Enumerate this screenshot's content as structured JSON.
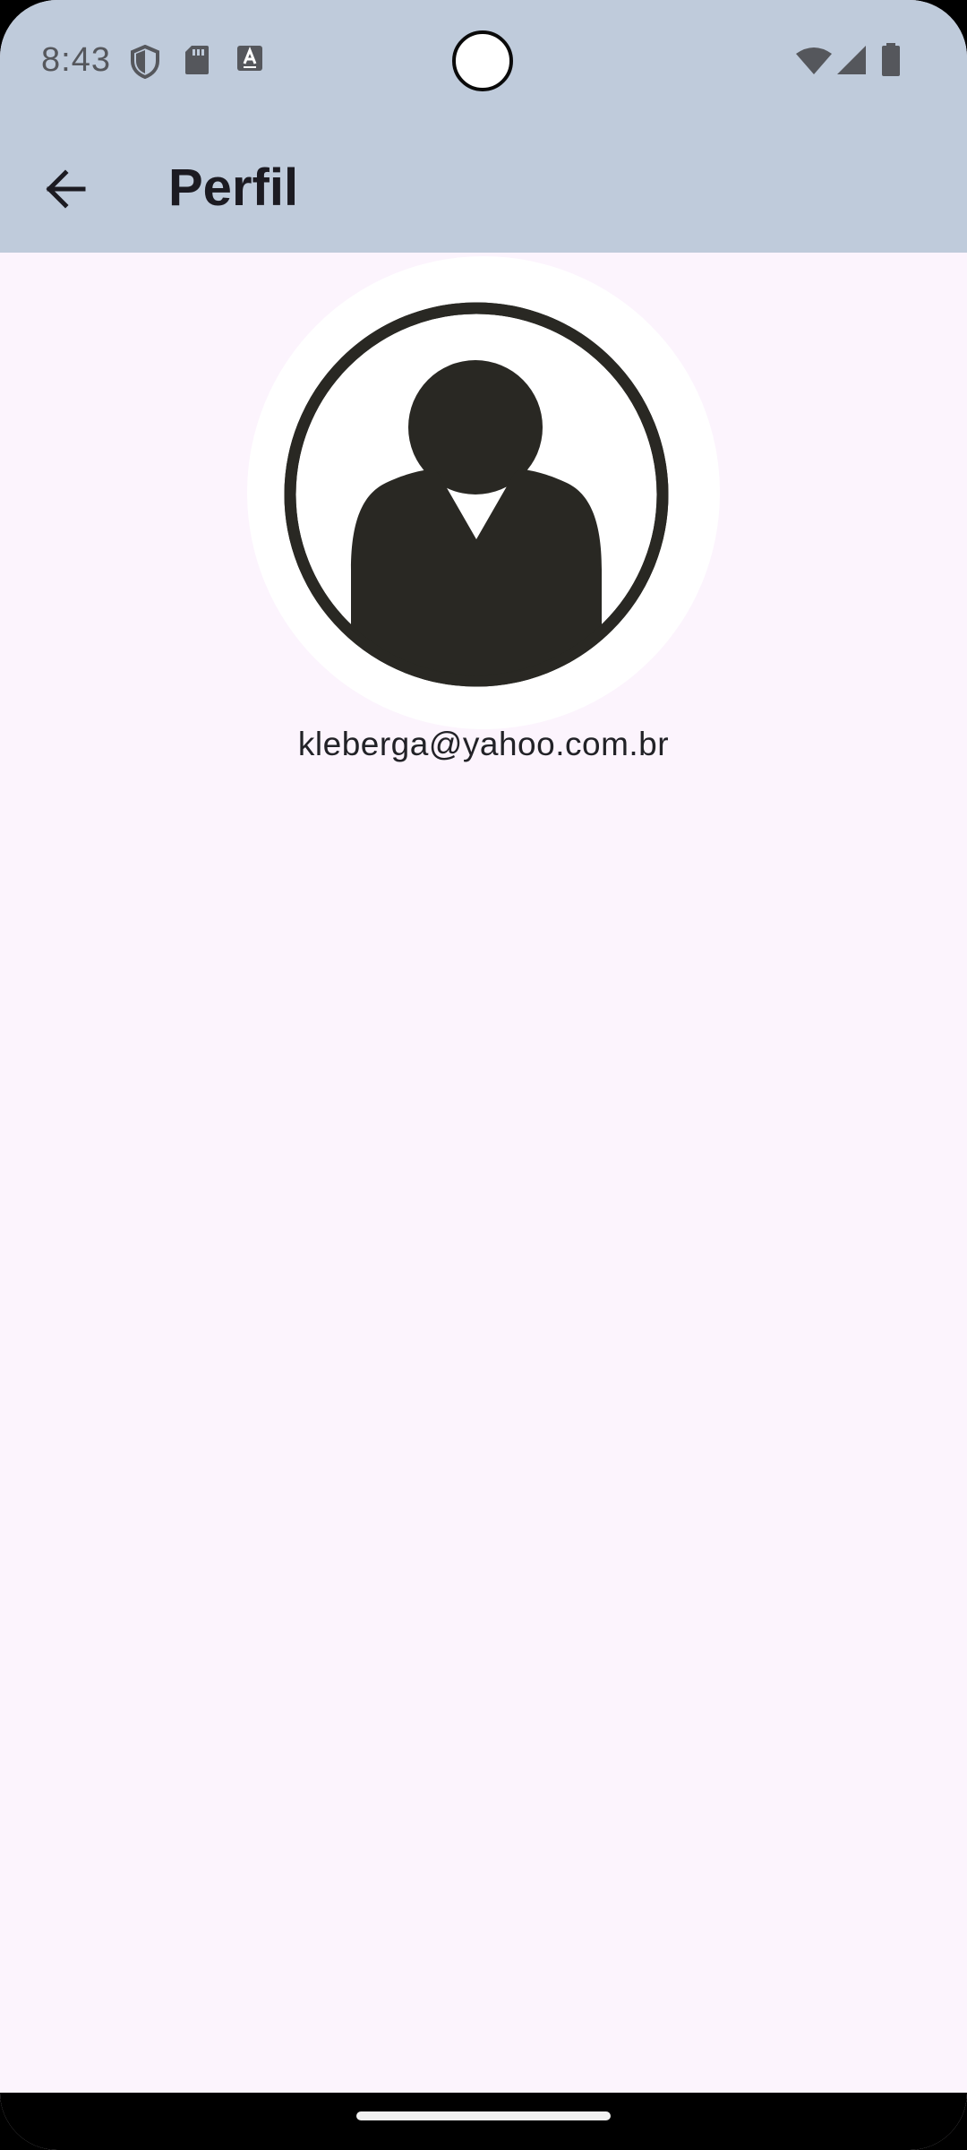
{
  "status_bar": {
    "time": "8:43",
    "icons_left": [
      "shield-icon",
      "sd-card-icon",
      "keyboard-a-icon"
    ],
    "icons_right": [
      "wifi-icon",
      "cell-signal-icon",
      "battery-icon"
    ]
  },
  "app_bar": {
    "back_icon": "arrow-back-icon",
    "title": "Perfil"
  },
  "profile": {
    "avatar_icon": "person-avatar-icon",
    "email": "kleberga@yahoo.com.br"
  },
  "colors": {
    "app_bar_bg": "#bfcbdb",
    "page_bg": "#fcf4fd",
    "avatar_fg": "#292823",
    "title_text": "#1c1b22"
  }
}
